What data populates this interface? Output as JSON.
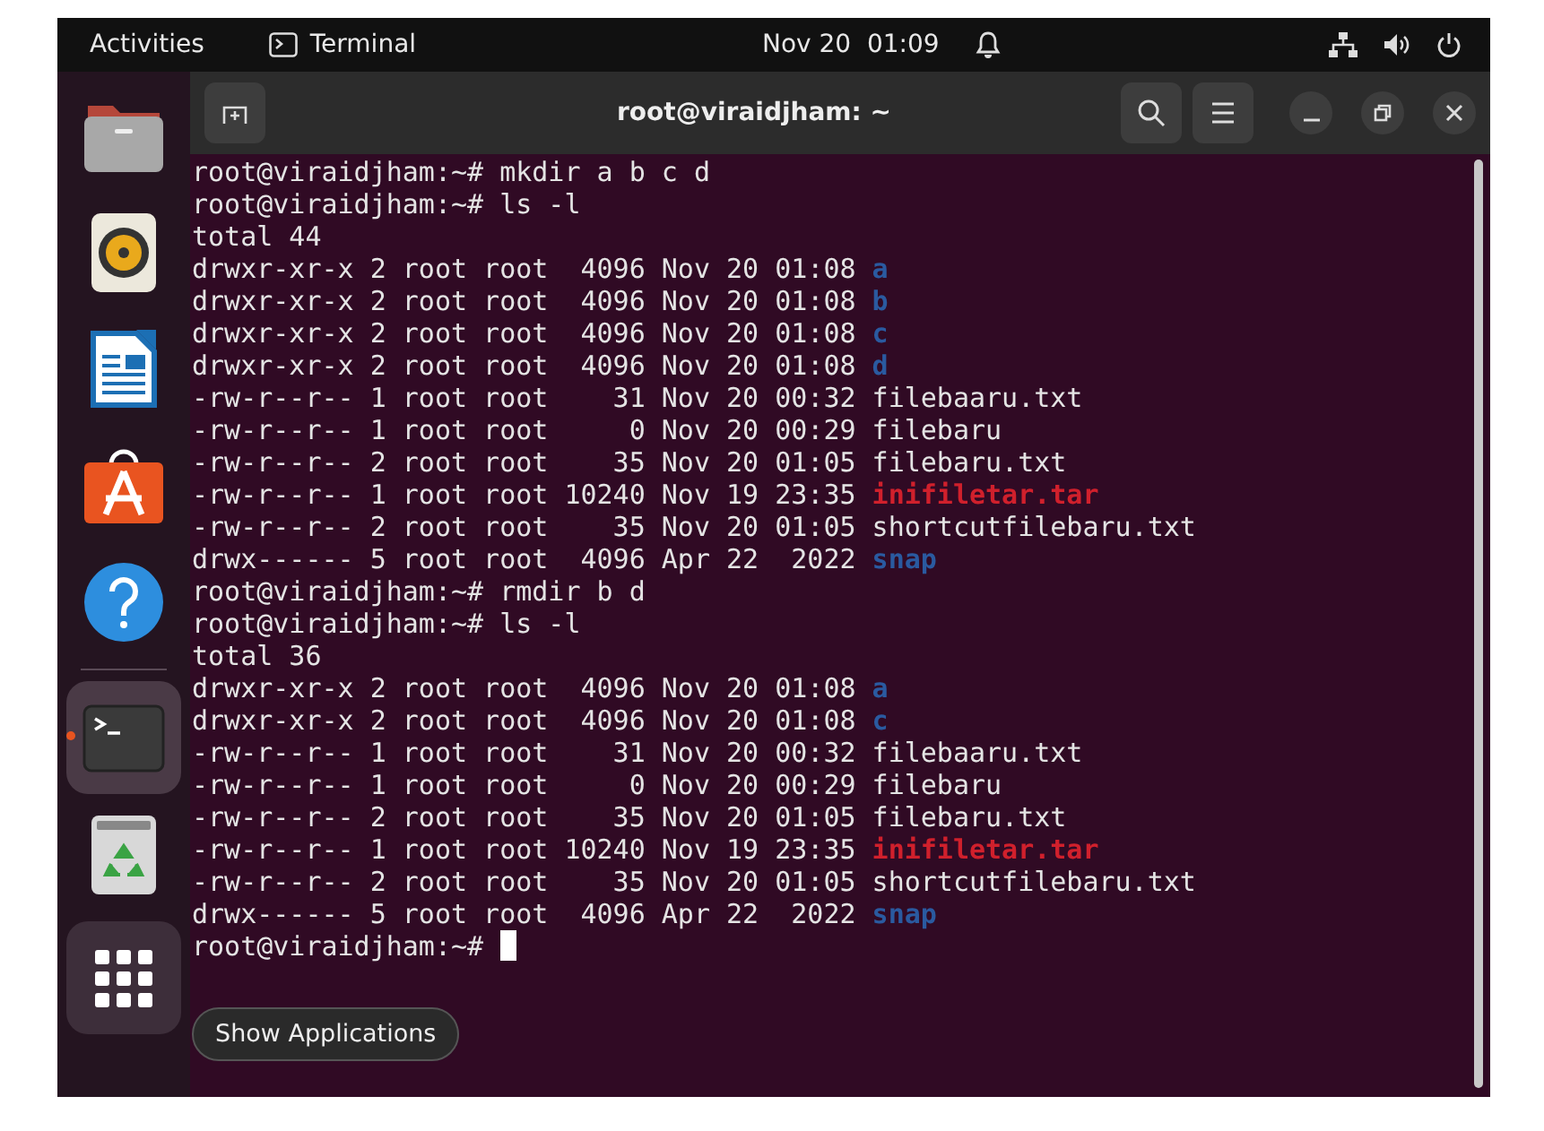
{
  "top_bar": {
    "activities": "Activities",
    "app_name": "Terminal",
    "clock": "Nov 20  01:09"
  },
  "dock": {
    "items": [
      {
        "kind": "files",
        "running": false
      },
      {
        "kind": "music",
        "running": false
      },
      {
        "kind": "writer",
        "running": false
      },
      {
        "kind": "store",
        "running": false
      },
      {
        "kind": "help",
        "running": false
      },
      {
        "kind": "terminal",
        "running": true
      },
      {
        "kind": "trash",
        "running": false
      }
    ],
    "show_apps_tooltip": "Show Applications"
  },
  "window": {
    "title": "root@viraidjham: ~"
  },
  "terminal": {
    "lines": [
      {
        "text": "root@viraidjham:~# mkdir a b c d"
      },
      {
        "text": "root@viraidjham:~# ls -l"
      },
      {
        "text": "total 44"
      },
      {
        "text": "drwxr-xr-x 2 root root  4096 Nov 20 01:08 ",
        "name": {
          "text": "a",
          "kind": "dir"
        }
      },
      {
        "text": "drwxr-xr-x 2 root root  4096 Nov 20 01:08 ",
        "name": {
          "text": "b",
          "kind": "dir"
        }
      },
      {
        "text": "drwxr-xr-x 2 root root  4096 Nov 20 01:08 ",
        "name": {
          "text": "c",
          "kind": "dir"
        }
      },
      {
        "text": "drwxr-xr-x 2 root root  4096 Nov 20 01:08 ",
        "name": {
          "text": "d",
          "kind": "dir"
        }
      },
      {
        "text": "-rw-r--r-- 1 root root    31 Nov 20 00:32 ",
        "name": {
          "text": "filebaaru.txt",
          "kind": "file"
        }
      },
      {
        "text": "-rw-r--r-- 1 root root     0 Nov 20 00:29 ",
        "name": {
          "text": "filebaru",
          "kind": "file"
        }
      },
      {
        "text": "-rw-r--r-- 2 root root    35 Nov 20 01:05 ",
        "name": {
          "text": "filebaru.txt",
          "kind": "file"
        }
      },
      {
        "text": "-rw-r--r-- 1 root root 10240 Nov 19 23:35 ",
        "name": {
          "text": "inifiletar.tar",
          "kind": "archive"
        }
      },
      {
        "text": "-rw-r--r-- 2 root root    35 Nov 20 01:05 ",
        "name": {
          "text": "shortcutfilebaru.txt",
          "kind": "file"
        }
      },
      {
        "text": "drwx------ 5 root root  4096 Apr 22  2022 ",
        "name": {
          "text": "snap",
          "kind": "dir"
        }
      },
      {
        "text": "root@viraidjham:~# rmdir b d"
      },
      {
        "text": "root@viraidjham:~# ls -l"
      },
      {
        "text": "total 36"
      },
      {
        "text": "drwxr-xr-x 2 root root  4096 Nov 20 01:08 ",
        "name": {
          "text": "a",
          "kind": "dir"
        }
      },
      {
        "text": "drwxr-xr-x 2 root root  4096 Nov 20 01:08 ",
        "name": {
          "text": "c",
          "kind": "dir"
        }
      },
      {
        "text": "-rw-r--r-- 1 root root    31 Nov 20 00:32 ",
        "name": {
          "text": "filebaaru.txt",
          "kind": "file"
        }
      },
      {
        "text": "-rw-r--r-- 1 root root     0 Nov 20 00:29 ",
        "name": {
          "text": "filebaru",
          "kind": "file"
        }
      },
      {
        "text": "-rw-r--r-- 2 root root    35 Nov 20 01:05 ",
        "name": {
          "text": "filebaru.txt",
          "kind": "file"
        }
      },
      {
        "text": "-rw-r--r-- 1 root root 10240 Nov 19 23:35 ",
        "name": {
          "text": "inifiletar.tar",
          "kind": "archive"
        }
      },
      {
        "text": "-rw-r--r-- 2 root root    35 Nov 20 01:05 ",
        "name": {
          "text": "shortcutfilebaru.txt",
          "kind": "file"
        }
      },
      {
        "text": "drwx------ 5 root root  4096 Apr 22  2022 ",
        "name": {
          "text": "snap",
          "kind": "dir"
        }
      },
      {
        "text": "root@viraidjham:~# ",
        "cursor": true
      }
    ]
  }
}
